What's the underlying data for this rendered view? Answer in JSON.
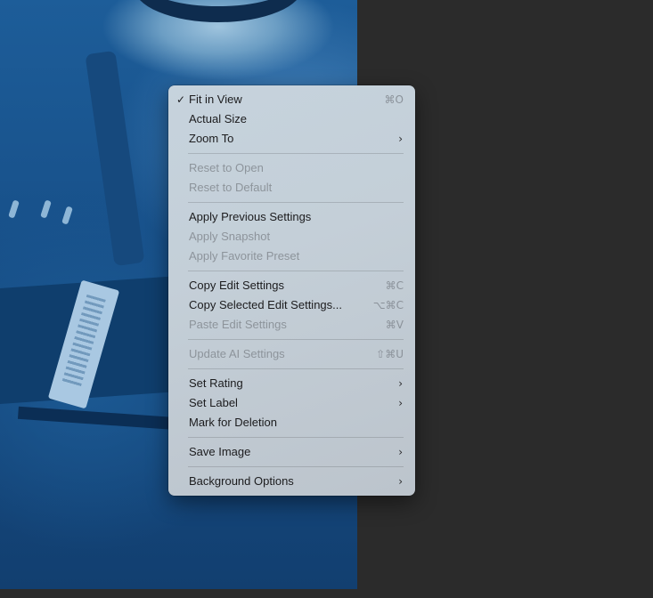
{
  "menu": {
    "fit_in_view": {
      "label": "Fit in View",
      "check": "✓",
      "shortcut": "⌘O"
    },
    "actual_size": {
      "label": "Actual Size"
    },
    "zoom_to": {
      "label": "Zoom To",
      "submenu": "›"
    },
    "reset_to_open": {
      "label": "Reset to Open"
    },
    "reset_to_default": {
      "label": "Reset to Default"
    },
    "apply_previous_settings": {
      "label": "Apply Previous Settings"
    },
    "apply_snapshot": {
      "label": "Apply Snapshot"
    },
    "apply_favorite_preset": {
      "label": "Apply Favorite Preset"
    },
    "copy_edit_settings": {
      "label": "Copy Edit Settings",
      "shortcut": "⌘C"
    },
    "copy_selected_edit_settings": {
      "label": "Copy Selected Edit Settings...",
      "shortcut": "⌥⌘C"
    },
    "paste_edit_settings": {
      "label": "Paste Edit Settings",
      "shortcut": "⌘V"
    },
    "update_ai_settings": {
      "label": "Update AI Settings",
      "shortcut": "⇧⌘U"
    },
    "set_rating": {
      "label": "Set Rating",
      "submenu": "›"
    },
    "set_label": {
      "label": "Set Label",
      "submenu": "›"
    },
    "mark_for_deletion": {
      "label": "Mark for Deletion"
    },
    "save_image": {
      "label": "Save Image",
      "submenu": "›"
    },
    "background_options": {
      "label": "Background Options",
      "submenu": "›"
    }
  }
}
